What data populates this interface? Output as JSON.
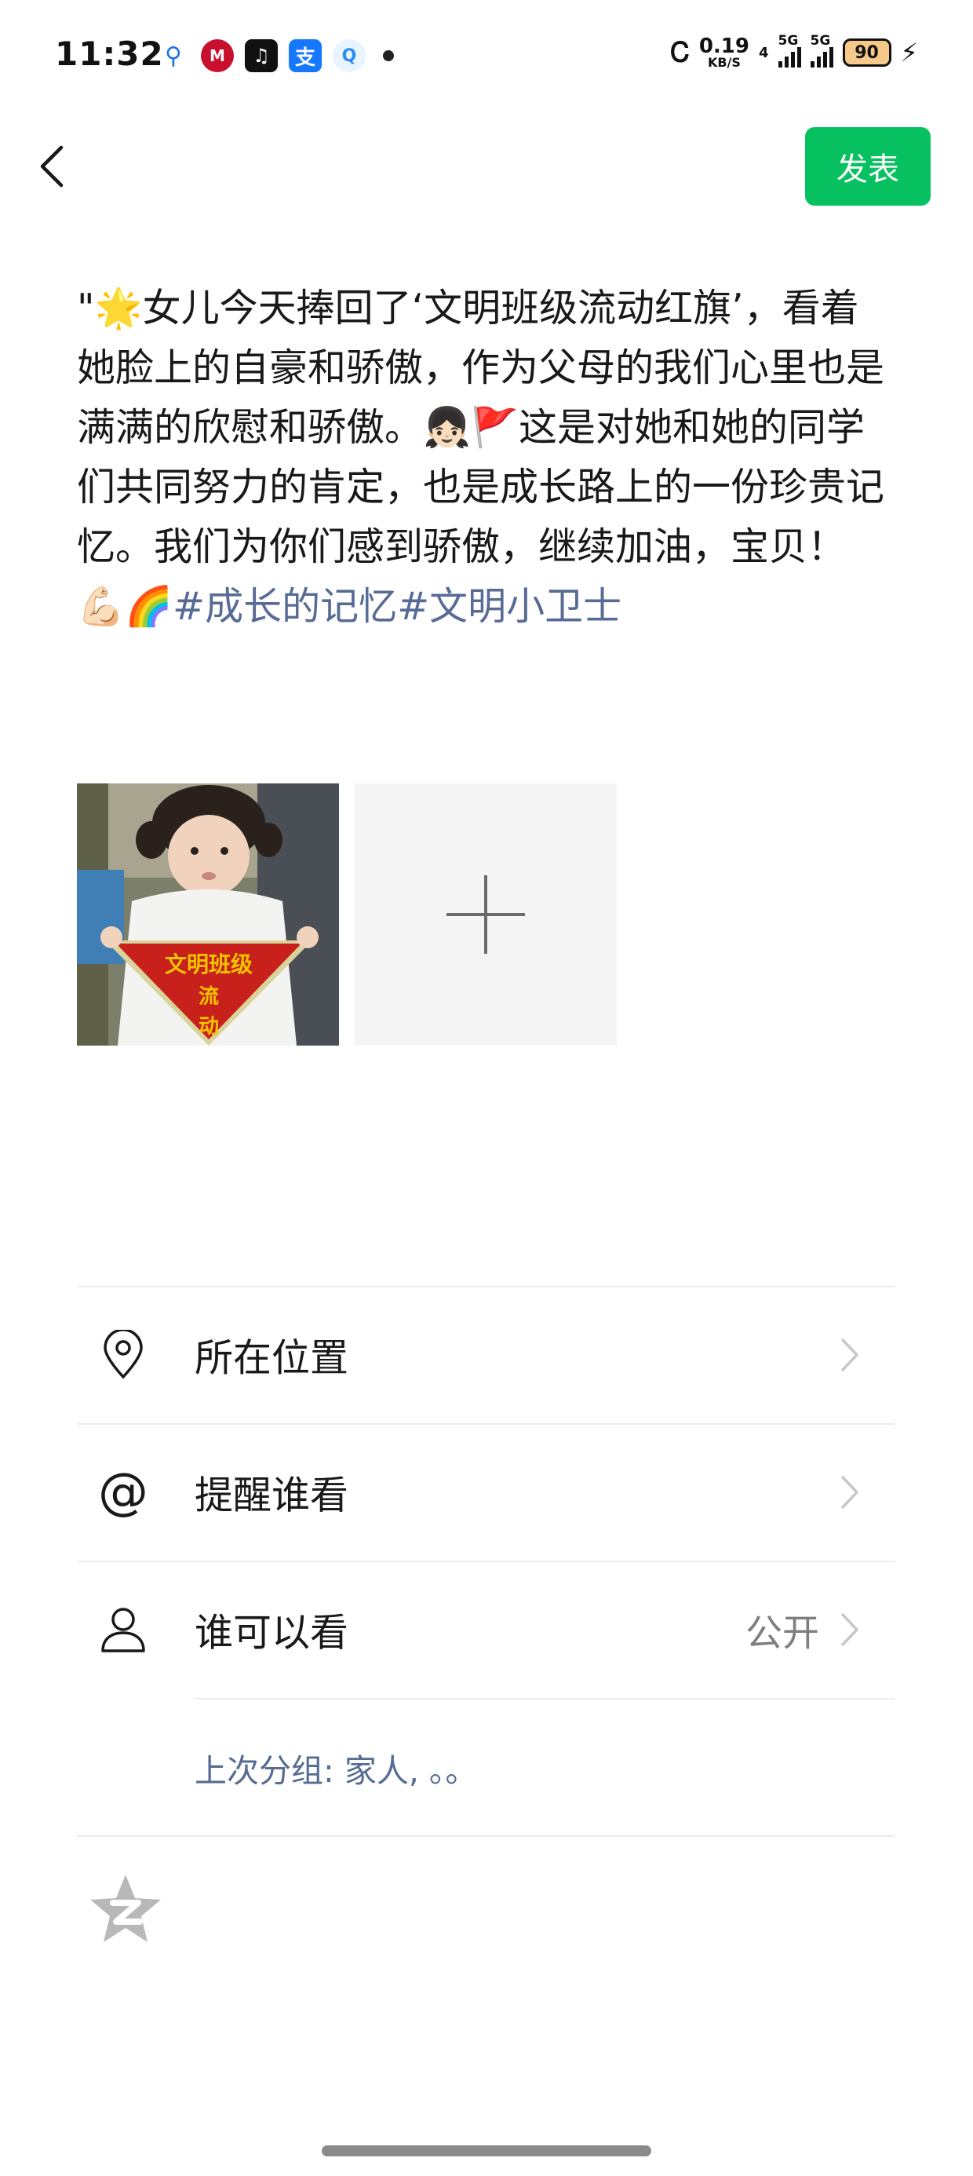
{
  "status_bar": {
    "time": "11:32",
    "app_icons": [
      "search-icon",
      "bank-icon",
      "tiktok-icon",
      "alipay-icon",
      "qq-browser-icon"
    ],
    "bluetooth": "bluetooth-icon",
    "net_speed_value": "0.19",
    "net_speed_unit": "KB/S",
    "sim1_label": "5G",
    "sim2_label": "5G",
    "wifi_label": "4",
    "battery_level": "90",
    "charging": "charging-icon"
  },
  "header": {
    "back_icon": "back-chevron-icon",
    "publish_label": "发表"
  },
  "post": {
    "text_parts": {
      "p1": "\"",
      "emoji_star": "🌟",
      "p2": "女儿今天捧回了‘文明班级流动红旗’，看着她脸上的自豪和骄傲，作为父母的我们心里也是满满的欣慰和骄傲。",
      "emoji_girl": "👧🏻",
      "emoji_flag": "🚩",
      "p3": "这是对她和她的同学们共同努力的肯定，也是成长路上的一份珍贵记忆。我们为你们感到骄傲，继续加油，宝贝！",
      "emoji_arm": "💪🏻",
      "emoji_rainbow": "🌈",
      "hashtag1": "#成长的记忆",
      "hashtag2": "#文明小卫士"
    }
  },
  "photos": {
    "image_1_caption": "文明班级流动红旗",
    "banner_text_lines": [
      "文明班级",
      "流",
      "动"
    ],
    "add_photo_icon": "plus-icon"
  },
  "options": {
    "location_label": "所在位置",
    "mention_label": "提醒谁看",
    "visibility_label": "谁可以看",
    "visibility_value": "公开",
    "last_group_text": "上次分组: 家人, 。。"
  },
  "colors": {
    "accent_green": "#07c160",
    "link_blue": "#576b95",
    "secondary_gray": "#7f7f7f"
  }
}
